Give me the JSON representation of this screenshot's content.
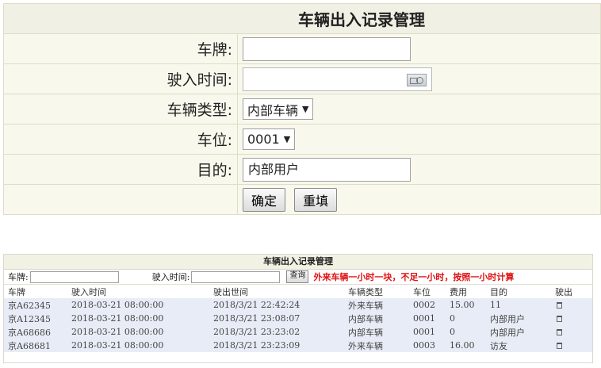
{
  "form": {
    "title": "车辆出入记录管理",
    "plate_label": "车牌:",
    "plate_value": "",
    "entry_time_label": "驶入时间:",
    "entry_time_value": "",
    "vehicle_type_label": "车辆类型:",
    "vehicle_type_value": "内部车辆",
    "spot_label": "车位:",
    "spot_value": "0001",
    "purpose_label": "目的:",
    "purpose_value": "内部用户",
    "confirm_label": "确定",
    "reset_label": "重填"
  },
  "list": {
    "title": "车辆出入记录管理",
    "search": {
      "plate_label": "车牌:",
      "entry_time_label": "驶入时间:",
      "query_label": "查询",
      "notice": "外来车辆一小时一块，不足一小时，按照一小时计算"
    },
    "columns": [
      "车牌",
      "驶入时间",
      "驶出世间",
      "车辆类型",
      "车位",
      "费用",
      "目的",
      "驶出"
    ],
    "rows": [
      [
        "京A62345",
        "2018-03-21 08:00:00",
        "2018/3/21 22:42:24",
        "外来车辆",
        "0002",
        "15.00",
        "11"
      ],
      [
        "京A12345",
        "2018-03-21 08:00:00",
        "2018/3/21 23:08:07",
        "内部车辆",
        "0001",
        "0",
        "内部用户"
      ],
      [
        "京A68686",
        "2018-03-21 08:00:00",
        "2018/3/21 23:23:02",
        "内部车辆",
        "0001",
        "0",
        "内部用户"
      ],
      [
        "京A68681",
        "2018-03-21 08:00:00",
        "2018/3/21 23:23:09",
        "外来车辆",
        "0003",
        "16.00",
        "访友"
      ]
    ],
    "row_action_icon": "trash-icon"
  }
}
